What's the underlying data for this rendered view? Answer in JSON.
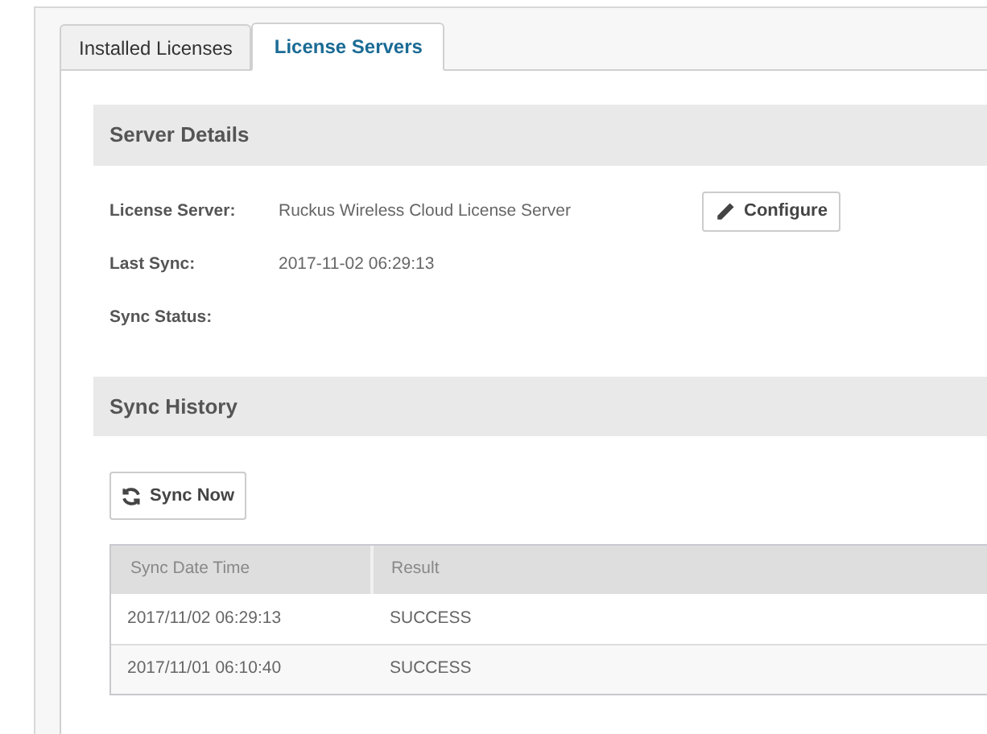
{
  "tabs": [
    {
      "label": "Installed Licenses",
      "selected": false
    },
    {
      "label": "License Servers",
      "selected": true
    }
  ],
  "server_details": {
    "title": "Server Details",
    "fields": [
      {
        "label": "License Server:",
        "value": "Ruckus Wireless Cloud License Server"
      },
      {
        "label": "Last Sync:",
        "value": "2017-11-02 06:29:13"
      },
      {
        "label": "Sync Status:"
      }
    ],
    "configure_button": "Configure"
  },
  "sync_history": {
    "title": "Sync History",
    "sync_button": "Sync Now",
    "table": {
      "columns": [
        "Sync Date Time",
        "Result"
      ],
      "rows": [
        [
          "2017/11/02 06:29:13",
          "SUCCESS"
        ],
        [
          "2017/11/01 06:10:40",
          "SUCCESS"
        ]
      ]
    }
  }
}
